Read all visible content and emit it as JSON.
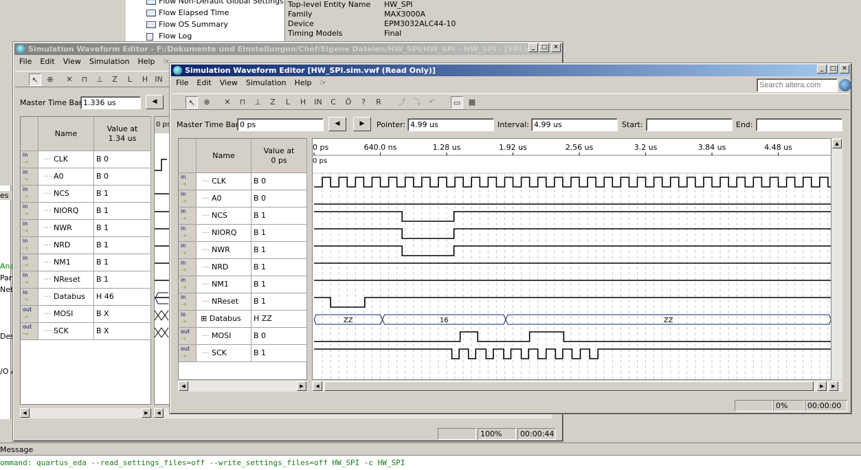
{
  "background": {
    "flow_items": [
      "Flow Non-Default Global Settings",
      "Flow Elapsed Time",
      "Flow OS Summary",
      "Flow Log"
    ],
    "summary": [
      {
        "key": "Top-level Entity Name",
        "value": "HW_SPI"
      },
      {
        "key": "Family",
        "value": "MAX3000A"
      },
      {
        "key": "Device",
        "value": "EPM3032ALC44-10"
      },
      {
        "key": "Timing Models",
        "value": "Final"
      }
    ],
    "left_labels": [
      "es",
      "Anal",
      "Part",
      "Netli",
      "Desi",
      "/O A"
    ],
    "message_label": "Message",
    "command_text": "ommand: quartus_eda --read_settings_files=off --write_settings_files=off HW_SPI -c HW_SPI"
  },
  "back_window": {
    "title": "Simulation Waveform Editor - F:/Dokumente und Einstellungen/Chef/Eigene Dateien/HW_SPI/HW_SPI - HW_SPI - [SPI.vwf.vwf]",
    "menu": [
      "File",
      "Edit",
      "View",
      "Simulation",
      "Help"
    ],
    "master_time_bar_label": "Master Time Bar:",
    "master_time_bar_value": "1.336 us",
    "col_name": "Name",
    "col_value": "Value at\n1.34 us",
    "axis_start": "0 ps",
    "status_zoom": "100%",
    "status_time": "00:00:44",
    "rows": [
      {
        "pin": "in",
        "name": "CLK",
        "value": "B 0"
      },
      {
        "pin": "in",
        "name": "A0",
        "value": "B 0"
      },
      {
        "pin": "in",
        "name": "NCS",
        "value": "B 1"
      },
      {
        "pin": "in",
        "name": "NIORQ",
        "value": "B 1"
      },
      {
        "pin": "in",
        "name": "NWR",
        "value": "B 1"
      },
      {
        "pin": "in",
        "name": "NRD",
        "value": "B 1"
      },
      {
        "pin": "in",
        "name": "NM1",
        "value": "B 1"
      },
      {
        "pin": "in",
        "name": "NReset",
        "value": "B 1"
      },
      {
        "pin": "io",
        "name": "Databus",
        "value": "H 46"
      },
      {
        "pin": "out",
        "name": "MOSI",
        "value": "B X"
      },
      {
        "pin": "out",
        "name": "SCK",
        "value": "B X"
      }
    ]
  },
  "front_window": {
    "title": "Simulation Waveform Editor  [HW_SPI.sim.vwf (Read Only)]",
    "menu": [
      "File",
      "Edit",
      "View",
      "Simulation",
      "Help"
    ],
    "search_placeholder": "Search altera.com",
    "master_time_bar_label": "Master Time Bar:",
    "master_time_bar_value": "0 ps",
    "pointer_label": "Pointer:",
    "pointer_value": "4.99 us",
    "interval_label": "Interval:",
    "interval_value": "4.99 us",
    "start_label": "Start:",
    "start_value": "",
    "end_label": "End:",
    "end_value": "",
    "col_name": "Name",
    "col_value": "Value at\n0 ps",
    "axis_ticks": [
      "0 ps",
      "640.0 ns",
      "1.28 us",
      "1.92 us",
      "2.56 us",
      "3.2 us",
      "3.84 us",
      "4.48 us"
    ],
    "axis_tick_times_us": [
      0,
      0.64,
      1.28,
      1.92,
      2.56,
      3.2,
      3.84,
      4.48
    ],
    "cursor_label": "0 ps",
    "status_percent": "0%",
    "status_time": "00:00:00",
    "rows": [
      {
        "pin": "in",
        "name": "CLK",
        "value": "B 0"
      },
      {
        "pin": "in",
        "name": "A0",
        "value": "B 0"
      },
      {
        "pin": "in",
        "name": "NCS",
        "value": "B 1"
      },
      {
        "pin": "in",
        "name": "NIORQ",
        "value": "B 1"
      },
      {
        "pin": "in",
        "name": "NWR",
        "value": "B 1"
      },
      {
        "pin": "in",
        "name": "NRD",
        "value": "B 1"
      },
      {
        "pin": "in",
        "name": "NM1",
        "value": "B 1"
      },
      {
        "pin": "in",
        "name": "NReset",
        "value": "B 1"
      },
      {
        "pin": "io",
        "name": "Databus",
        "value": "H ZZ",
        "expandable": true
      },
      {
        "pin": "out",
        "name": "MOSI",
        "value": "B 0"
      },
      {
        "pin": "out",
        "name": "SCK",
        "value": "B 1"
      }
    ],
    "waves": {
      "end_us": 4.99,
      "clk_period_us": 0.16,
      "A0": {
        "initial": 0,
        "edges": []
      },
      "NCS": {
        "initial": 1,
        "edges": [
          0.85,
          1.35
        ]
      },
      "NIORQ": {
        "initial": 1,
        "edges": [
          0.85,
          1.35
        ]
      },
      "NWR": {
        "initial": 1,
        "edges": [
          0.85,
          1.35
        ]
      },
      "NRD": {
        "initial": 1,
        "edges": []
      },
      "NM1": {
        "initial": 1,
        "edges": []
      },
      "NReset": {
        "initial": 1,
        "edges": [
          0.16,
          0.49
        ]
      },
      "MOSI": {
        "initial": 0,
        "edges": [
          1.41,
          1.58,
          2.08,
          2.41
        ]
      },
      "SCK": {
        "initial": 1,
        "edges": [
          1.33,
          1.4,
          1.49,
          1.56,
          1.66,
          1.73,
          1.83,
          1.9,
          2.0,
          2.07,
          2.16,
          2.24,
          2.33,
          2.4,
          2.49,
          2.57,
          2.66,
          2.74
        ]
      },
      "Databus": [
        {
          "label": "ZZ",
          "start": 0,
          "end": 0.66
        },
        {
          "label": "16",
          "start": 0.66,
          "end": 1.85
        },
        {
          "label": "ZZ",
          "start": 1.85,
          "end": 4.99
        }
      ]
    }
  }
}
